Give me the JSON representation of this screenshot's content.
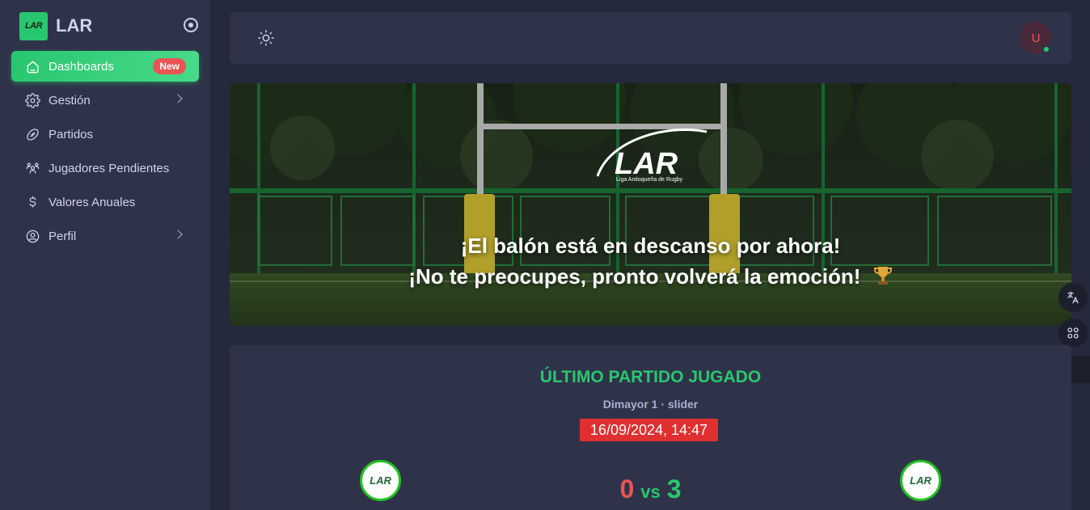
{
  "brand": {
    "logo_text": "LAR",
    "name": "LAR"
  },
  "sidebar": {
    "items": [
      {
        "label": "Dashboards",
        "icon": "home-icon",
        "badge": "New",
        "active": true
      },
      {
        "label": "Gestión",
        "icon": "settings-icon",
        "has_submenu": true
      },
      {
        "label": "Partidos",
        "icon": "rugby-ball-icon"
      },
      {
        "label": "Jugadores Pendientes",
        "icon": "users-icon"
      },
      {
        "label": "Valores Anuales",
        "icon": "dollar-icon"
      },
      {
        "label": "Perfil",
        "icon": "user-circle-icon",
        "has_submenu": true
      }
    ]
  },
  "navbar": {
    "avatar_initial": "U",
    "status": "online"
  },
  "banner": {
    "logo_text": "LAR",
    "logo_subtitle": "Liga Antioqueña de Rugby",
    "line1": "¡El balón está en descanso por ahora!",
    "line2": "¡No te preocupes, pronto volverá la emoción!"
  },
  "match": {
    "title": "ÚLTIMO PARTIDO JUGADO",
    "subtitle": "Dimayor 1 · slider",
    "datetime": "16/09/2024, 14:47",
    "home_logo_text": "LAR",
    "away_logo_text": "LAR",
    "home_score": "0",
    "vs": "vs",
    "away_score": "3"
  },
  "colors": {
    "accent": "#28c76f",
    "danger": "#ea5455",
    "bg": "#25293c",
    "card": "#2f3349"
  }
}
